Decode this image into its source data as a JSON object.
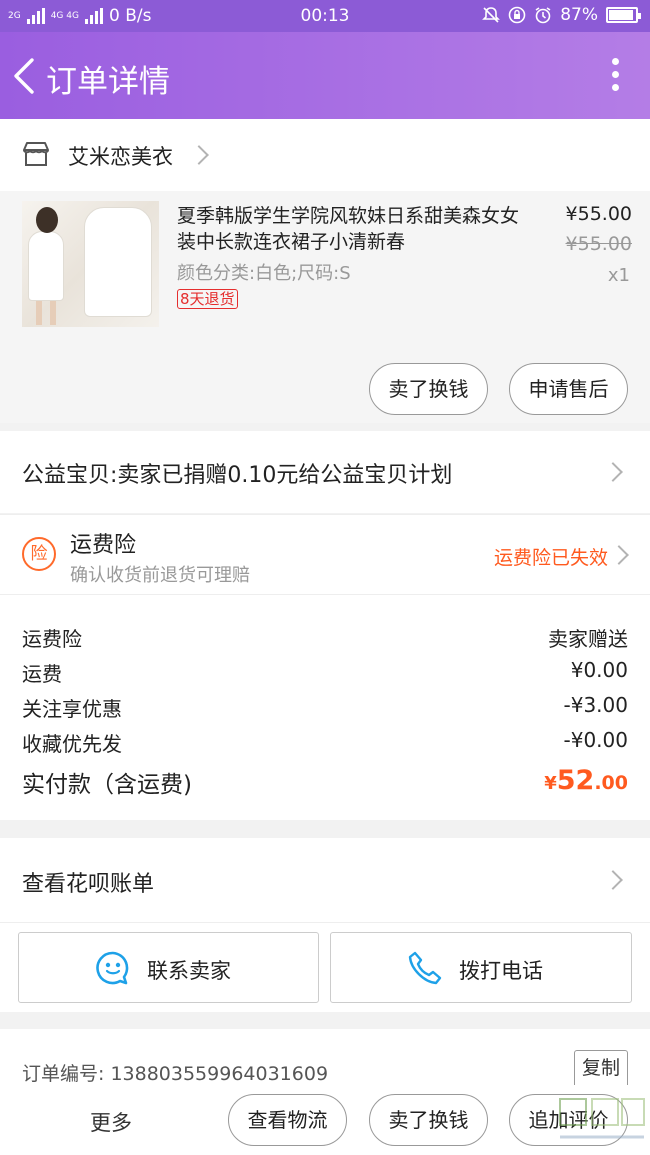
{
  "status_bar": {
    "net_a": "2G",
    "net_b": "4G 4G",
    "speed": "0 B/s",
    "time": "00:13",
    "battery": "87%"
  },
  "header": {
    "title": "订单详情"
  },
  "store": {
    "name": "艾米恋美衣"
  },
  "product": {
    "title": "夏季韩版学生学院风软妹日系甜美森女女装中长款连衣裙子小清新春",
    "spec": "颜色分类:白色;尺码:S",
    "badge": "8天退货",
    "price": "¥55.00",
    "original_price": "¥55.00",
    "quantity": "x1",
    "actions": {
      "sell": "卖了换钱",
      "after_sale": "申请售后"
    }
  },
  "charity": {
    "text": "公益宝贝:卖家已捐赠0.10元给公益宝贝计划"
  },
  "insurance": {
    "icon_char": "险",
    "title": "运费险",
    "subtitle": "确认收货前退货可理赔",
    "status": "运费险已失效"
  },
  "fees": {
    "rows": [
      {
        "label": "运费险",
        "value": "卖家赠送"
      },
      {
        "label": "运费",
        "value": "¥0.00"
      },
      {
        "label": "关注享优惠",
        "value": "-¥3.00"
      },
      {
        "label": "收藏优先发",
        "value": "-¥0.00"
      }
    ],
    "total": {
      "label": "实付款（含运费)",
      "currency": "¥",
      "integer": "52",
      "decimal": ".00"
    }
  },
  "huabei": {
    "text": "查看花呗账单"
  },
  "contact": {
    "seller": "联系卖家",
    "call": "拨打电话"
  },
  "order": {
    "number": "订单编号: 1388035599640316​09",
    "copy": "复制"
  },
  "bottom": {
    "more": "更多",
    "logistics": "查看物流",
    "sell": "卖了换钱",
    "review": "追加评价"
  },
  "colors": {
    "header": "#9a5ee0",
    "accent_orange": "#ff5a1f",
    "badge_red": "#e52e2e"
  }
}
